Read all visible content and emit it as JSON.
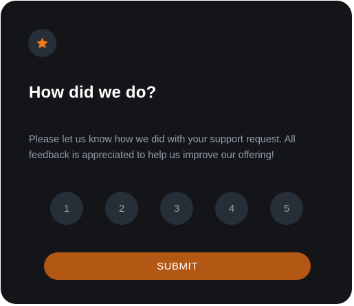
{
  "card": {
    "icon": "star-icon",
    "title": "How did we do?",
    "description": "Please let us know how we did with your support request. All feedback is appreciated to help us improve our offering!",
    "ratings": [
      "1",
      "2",
      "3",
      "4",
      "5"
    ],
    "submit_label": "SUBMIT"
  },
  "colors": {
    "card_background": "#141519",
    "badge_background": "#262e38",
    "star": "#fc7614",
    "text_muted": "#959eac",
    "submit_background": "#b25714",
    "title": "#ffffff"
  }
}
